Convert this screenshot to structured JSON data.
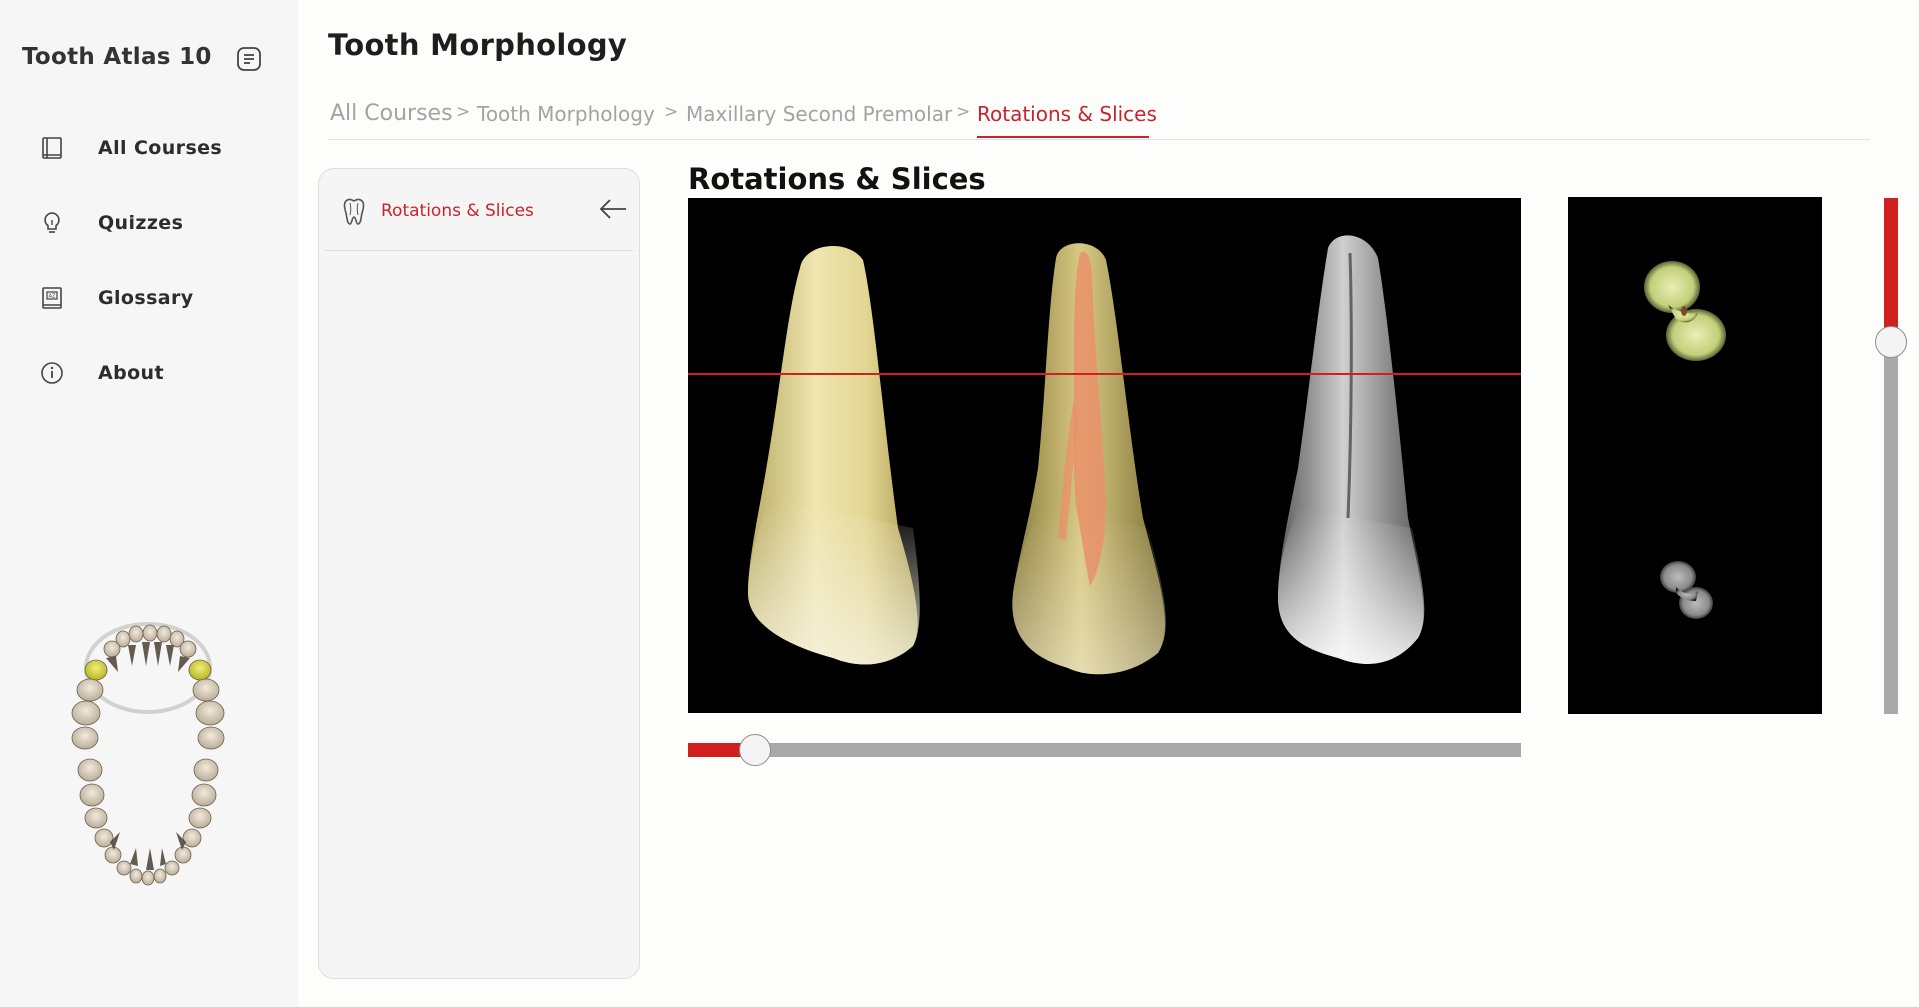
{
  "app": {
    "title": "Tooth Atlas 10"
  },
  "sidebar": {
    "items": [
      {
        "label": "All Courses",
        "icon": "book-icon"
      },
      {
        "label": "Quizzes",
        "icon": "lightbulb-icon"
      },
      {
        "label": "Glossary",
        "icon": "glossary-icon"
      },
      {
        "label": "About",
        "icon": "info-icon"
      }
    ],
    "highlight_color": "#d9d32b"
  },
  "main": {
    "title": "Tooth Morphology"
  },
  "breadcrumb": {
    "items": [
      "All Courses",
      "Tooth Morphology",
      "Maxillary Second Premolar",
      "Rotations & Slices"
    ],
    "separator": ">",
    "active_color": "#c8242a"
  },
  "panel": {
    "item_label": "Rotations & Slices"
  },
  "viewer": {
    "title": "Rotations & Slices",
    "rotation_progress": 0.08,
    "slice_progress": 0.28
  }
}
